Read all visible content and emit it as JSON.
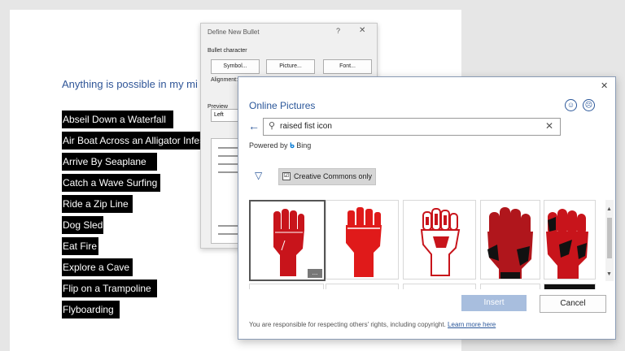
{
  "document": {
    "heading": "Anything is possible in my mi",
    "bullets": [
      "Abseil Down a Waterfall",
      "Air Boat Across an Alligator Infest",
      "Arrive By Seaplane",
      "Catch a Wave Surfing",
      "Ride a Zip Line",
      "Dog Sled",
      "Eat Fire",
      "Explore a Cave",
      "Flip on a Trampoline",
      "Flyboarding"
    ]
  },
  "define_new_bullet": {
    "title": "Define New Bullet",
    "help": "?",
    "close": "✕",
    "bullet_character_label": "Bullet character",
    "symbol_button": "Symbol...",
    "picture_button": "Picture...",
    "font_button": "Font...",
    "alignment_label": "Alignment:",
    "alignment_value": "Left",
    "preview_label": "Preview"
  },
  "online_pictures": {
    "close": "✕",
    "title": "Online Pictures",
    "back": "←",
    "search_value": "raised fist icon",
    "clear": "✕",
    "powered_by": "Powered by",
    "bing": "Bing",
    "filter_label": "Creative Commons only",
    "filter_checked": "☑",
    "more": "...",
    "insert_button": "Insert",
    "cancel_button": "Cancel",
    "footer_text": "You are responsible for respecting others' rights, including copyright.",
    "learn_more": "Learn more here",
    "icons": {
      "back": "arrow-left-icon",
      "search": "search-icon",
      "filter": "filter-icon",
      "smile": "smiley-icon",
      "frown": "frown-icon"
    },
    "colors": {
      "accent": "#2b579a",
      "fist_red": "#c8141b",
      "insert_disabled": "#a8bede"
    }
  }
}
